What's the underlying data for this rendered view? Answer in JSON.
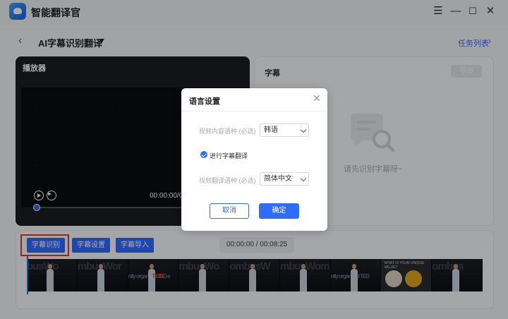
{
  "app": {
    "title": "智能翻译官"
  },
  "header": {
    "title": "AI字幕识别翻译",
    "task_list": "任务列表"
  },
  "player": {
    "title": "播放器",
    "time": "00:00:00/00:08:25"
  },
  "subtitle_panel": {
    "title": "字幕",
    "export_label": "导出",
    "empty_text": "请先识别字幕呀~"
  },
  "toolbar": {
    "recognize_label": "字幕识别",
    "settings_label": "字幕设置",
    "import_label": "字幕导入",
    "time": "00:00:00 / 00:08:25"
  },
  "timeline": {
    "thumb_texts": [
      "busWo",
      "mbusWor",
      "ntly organized TED e",
      "mbusWo",
      "ombusW",
      "mbusWom",
      "ntly organized TED",
      "WHAT IS YOUR UNIQUE VALUE?",
      "ombus"
    ]
  },
  "dialog": {
    "title": "语言设置",
    "source_label": "视频内容语种 (必选)",
    "source_value": "韩语",
    "translate_checkbox": "进行字幕翻译",
    "target_label": "视频翻译语种 (必选)",
    "target_value": "简体中文",
    "cancel": "取消",
    "confirm": "确定"
  },
  "colors": {
    "accent": "#2f6bff",
    "highlight": "#e23a2e",
    "player_bg": "#1c1d22"
  }
}
